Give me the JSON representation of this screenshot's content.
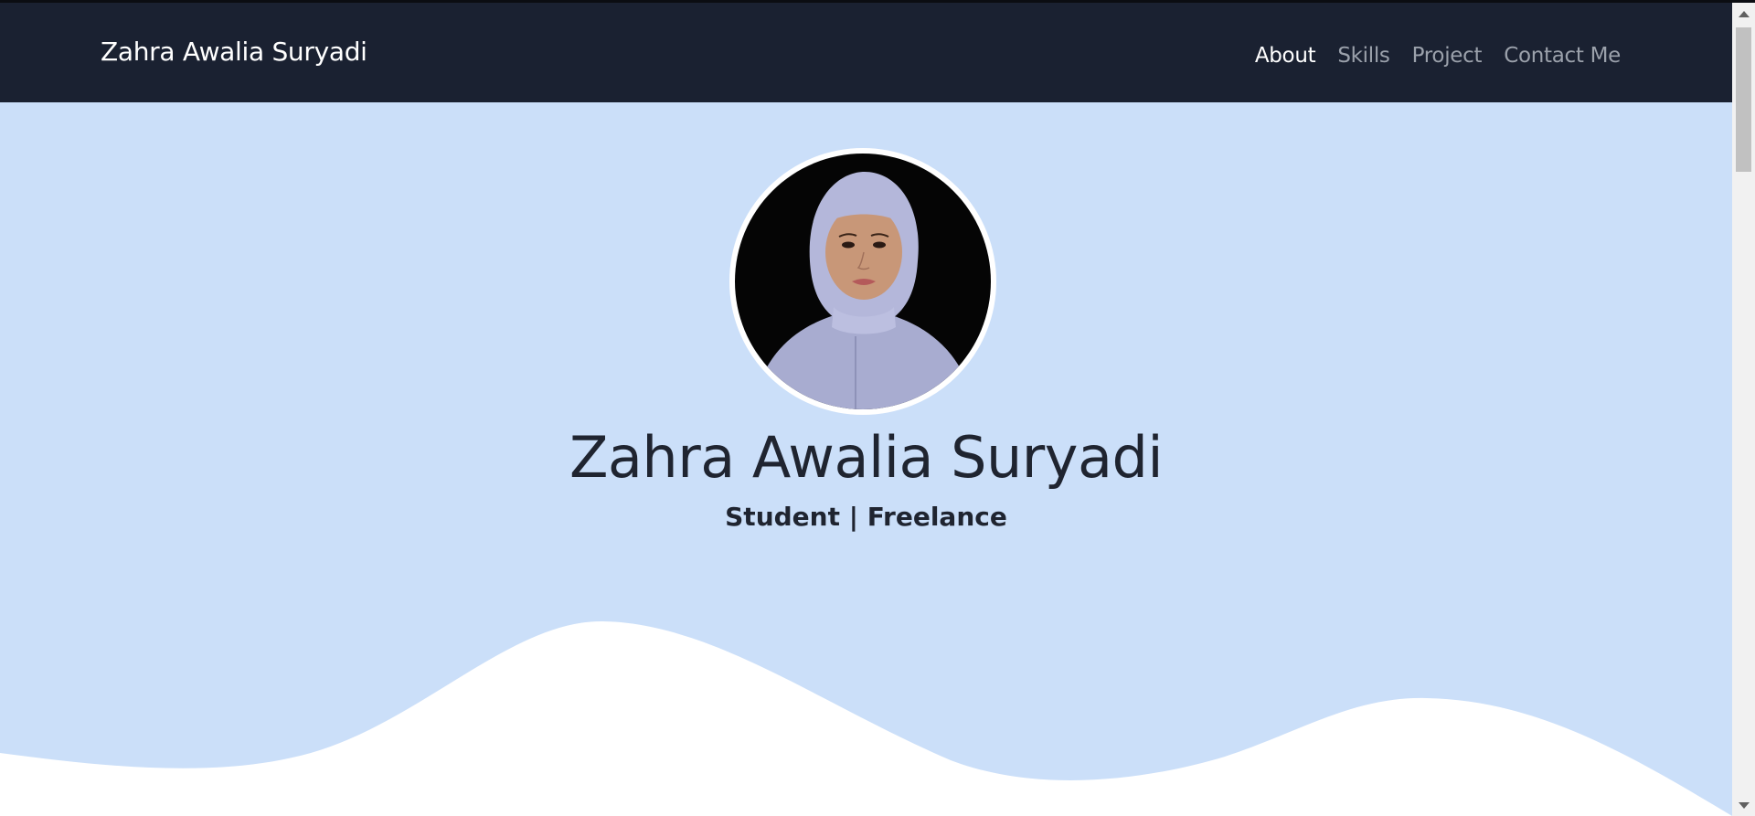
{
  "navbar": {
    "brand": "Zahra Awalia Suryadi",
    "links": [
      {
        "label": "About",
        "active": true
      },
      {
        "label": "Skills",
        "active": false
      },
      {
        "label": "Project",
        "active": false
      },
      {
        "label": "Contact Me",
        "active": false
      }
    ]
  },
  "hero": {
    "title": "Zahra Awalia Suryadi",
    "subtitle": "Student | Freelance"
  },
  "colors": {
    "navbar_bg": "#1a2131",
    "hero_bg": "#cbdff9",
    "text_dark": "#1f2430",
    "nav_inactive": "#9ba1ab"
  },
  "icons": {
    "avatar": "profile-photo"
  }
}
